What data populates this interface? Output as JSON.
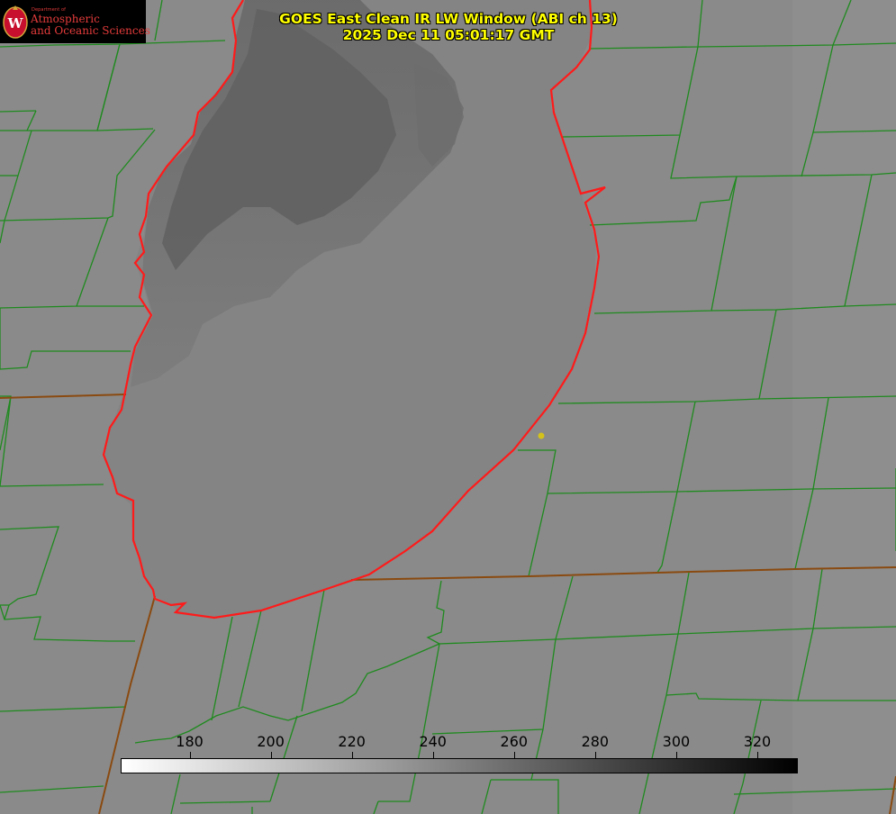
{
  "logo": {
    "department": "Department of",
    "line1": "Atmospheric",
    "line2": "and Oceanic Sciences",
    "seal_letter": "W"
  },
  "title": {
    "line1": "GOES East Clean IR LW Window (ABI ch 13)",
    "line2": "2025 Dec 11 05:01:17 GMT"
  },
  "colorbar": {
    "min": 163,
    "max": 330,
    "ticks": [
      "180",
      "200",
      "220",
      "240",
      "260",
      "280",
      "300",
      "320"
    ],
    "gradient_from": "#ffffff",
    "gradient_to": "#000000"
  },
  "colors": {
    "background": "#8a8a8a",
    "county_lines": "#1f8a1f",
    "state_lines": "#8a4a10",
    "lake_outline": "#ff1a1a",
    "title_text": "#ffff00",
    "logo_text": "#e53b3b"
  },
  "map": {
    "feature": "lake-michigan-southern-basin",
    "marker": "city-marker"
  }
}
